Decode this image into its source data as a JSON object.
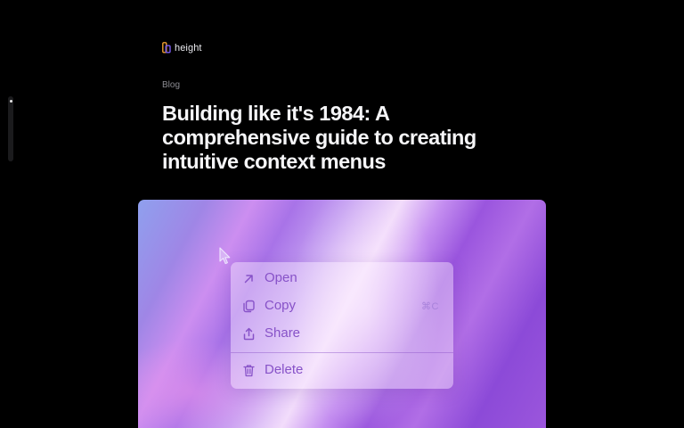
{
  "brand": {
    "name": "height",
    "icon": "height-logo-icon"
  },
  "breadcrumb": "Blog",
  "article": {
    "title": "Building like it's 1984: A comprehensive guide to creating intuitive context menus"
  },
  "hero": {
    "context_menu": {
      "items": [
        {
          "label": "Open",
          "icon": "arrow-up-right-icon",
          "shortcut": ""
        },
        {
          "label": "Copy",
          "icon": "copy-icon",
          "shortcut": "⌘C"
        },
        {
          "label": "Share",
          "icon": "share-icon",
          "shortcut": ""
        },
        {
          "label": "Delete",
          "icon": "trash-icon",
          "shortcut": ""
        }
      ]
    }
  },
  "colors": {
    "background": "#000000",
    "menu_text": "#8752c8",
    "hero_purple": "#9a55de"
  }
}
